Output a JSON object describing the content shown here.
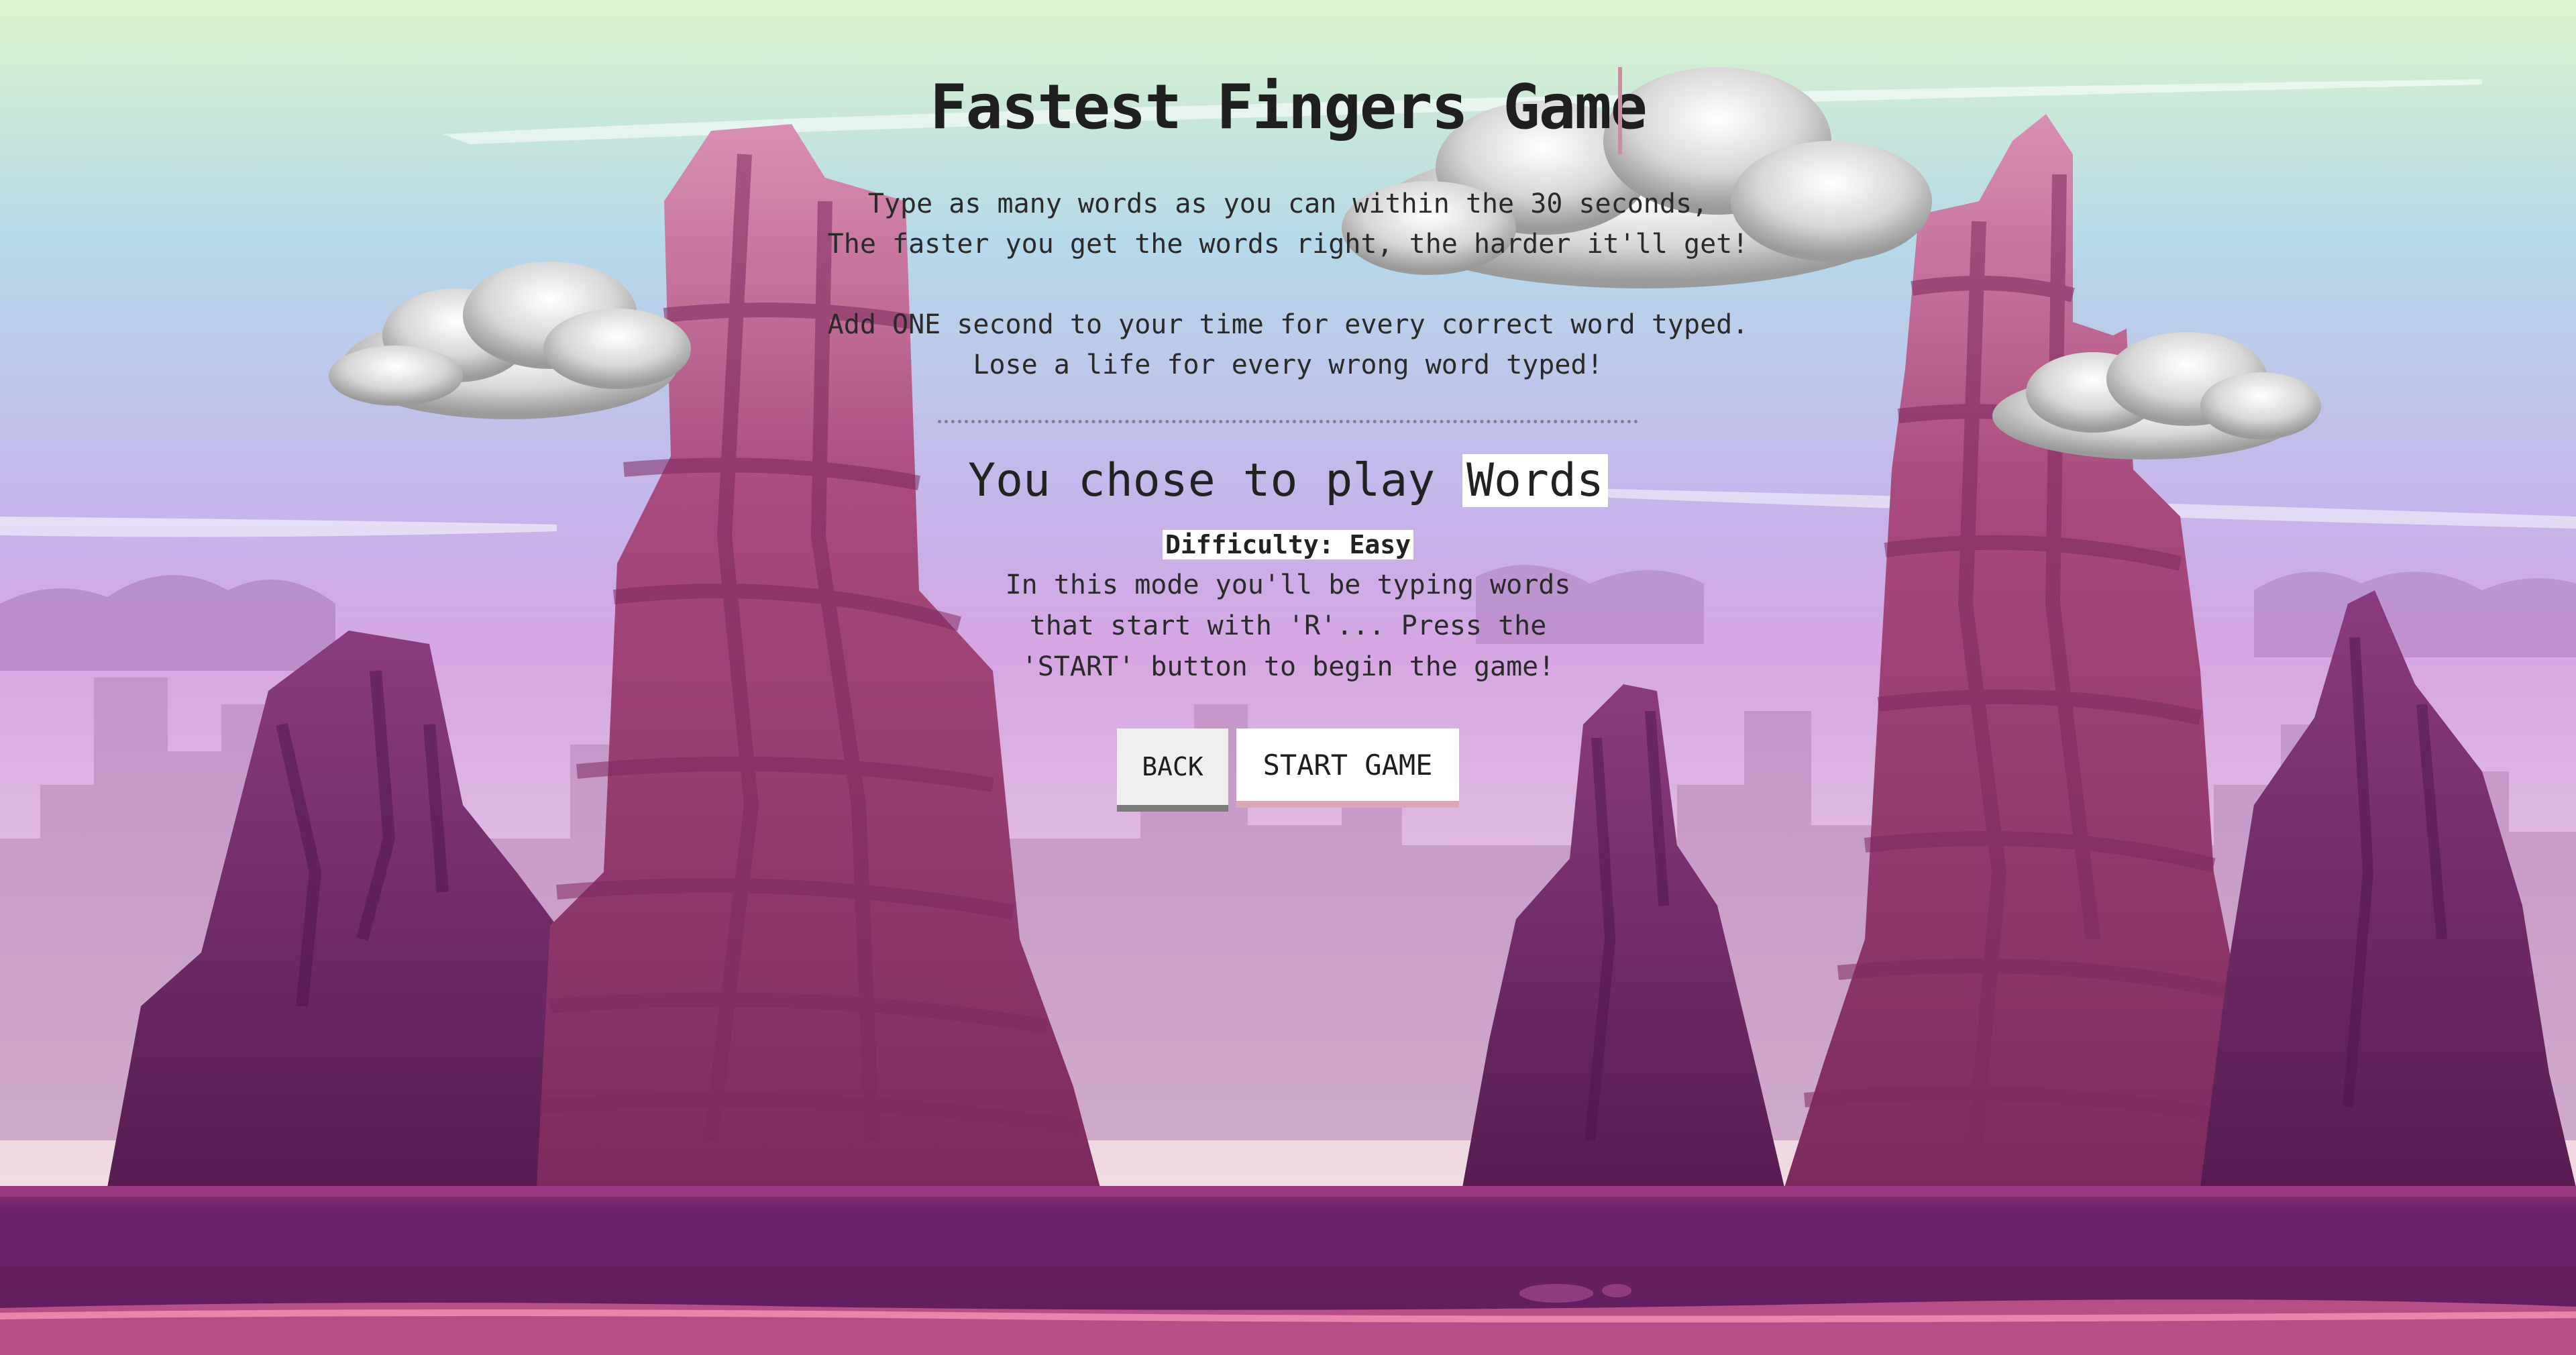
{
  "page": {
    "title": "Fastest Fingers Game"
  },
  "instructions": {
    "line1": "Type as many words as you can within the 30 seconds,",
    "line2": "The faster you get the words right, the harder it'll get!",
    "line3": "Add ONE second to your time for every correct word typed.",
    "line4": "Lose a life for every wrong word typed!"
  },
  "mode": {
    "prefix": "You chose to play",
    "name": "Words",
    "difficulty_label": "Difficulty:",
    "difficulty_value": "Easy",
    "description": "In this mode you'll be typing words that start with 'R'... Press the 'START' button to begin the game!"
  },
  "buttons": {
    "back_label": "BACK",
    "start_label": "START GAME"
  },
  "colors": {
    "sky_top": "#d8f2cf",
    "sky_mid": "#b7d3f0",
    "sky_low": "#d9a8e6",
    "rock_pink": "#a64a7a",
    "rock_purple": "#6a2460",
    "ground": "#6e2466",
    "accent": "#d9a7b5"
  },
  "icons": {
    "cloud": "cloud-icon"
  }
}
